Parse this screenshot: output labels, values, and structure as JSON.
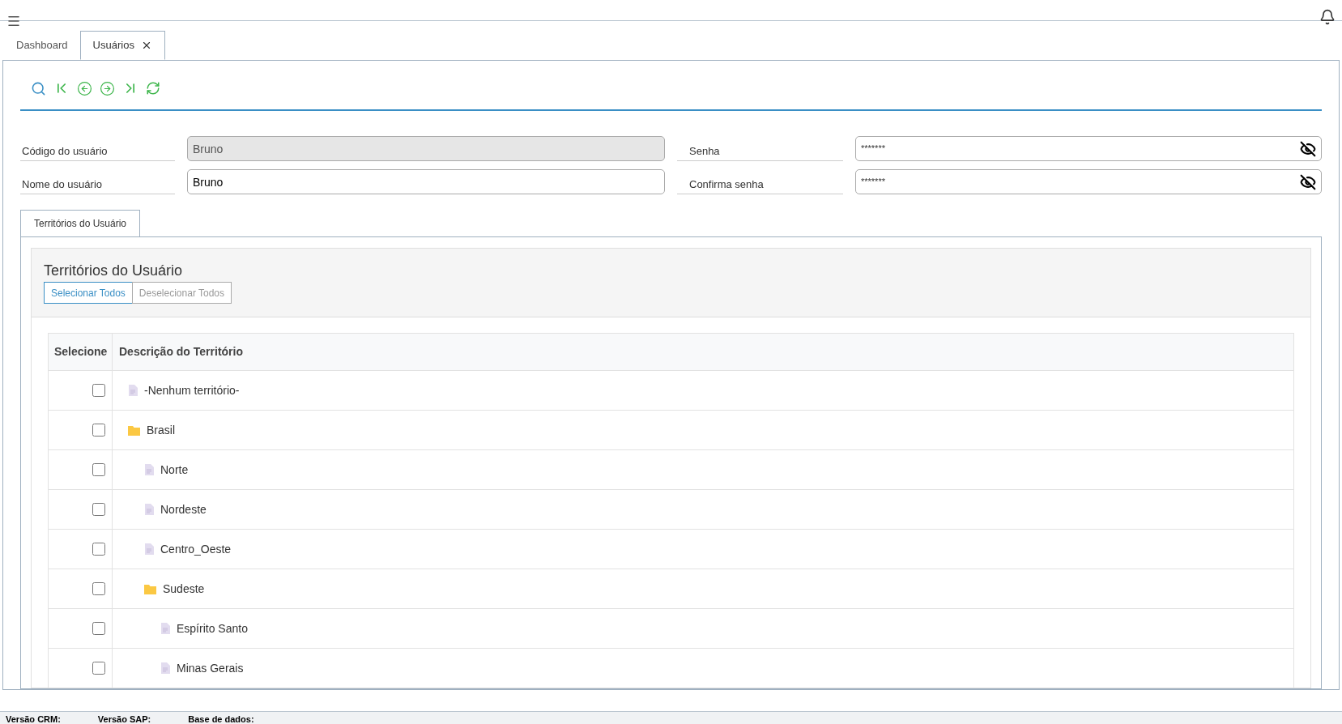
{
  "tabs": [
    {
      "label": "Dashboard",
      "selected": false,
      "closable": false
    },
    {
      "label": "Usuários",
      "selected": true,
      "closable": true
    }
  ],
  "form": {
    "left": [
      {
        "label": "Código do usuário",
        "value": "Bruno",
        "disabled": true
      },
      {
        "label": "Nome do usuário",
        "value": "Bruno",
        "disabled": false
      }
    ],
    "right": [
      {
        "label": "Senha",
        "value": "*******"
      },
      {
        "label": "Confirma senha",
        "value": "*******"
      }
    ]
  },
  "inner_tabs": [
    {
      "label": "Territórios do Usuário",
      "selected": true
    }
  ],
  "panel": {
    "title": "Territórios do Usuário",
    "buttons": [
      {
        "label": "Selecionar Todos",
        "selected": true
      },
      {
        "label": "Deselecionar Todos",
        "selected": false
      }
    ]
  },
  "table": {
    "columns": [
      "Selecione",
      "Descrição do Território"
    ],
    "rows": [
      {
        "label": "-Nenhum território-",
        "kind": "file",
        "checked": false
      },
      {
        "label": "Brasil",
        "kind": "folder",
        "checked": false,
        "children": [
          {
            "label": "Norte",
            "kind": "file",
            "checked": false
          },
          {
            "label": "Nordeste",
            "kind": "file",
            "checked": false
          },
          {
            "label": "Centro_Oeste",
            "kind": "file",
            "checked": false
          },
          {
            "label": "Sudeste",
            "kind": "folder",
            "checked": false,
            "children": [
              {
                "label": "Espírito Santo",
                "kind": "file",
                "checked": false
              },
              {
                "label": "Minas Gerais",
                "kind": "file",
                "checked": false
              }
            ]
          }
        ]
      }
    ]
  },
  "status_bar": [
    "Versão CRM:",
    "Versão SAP:",
    "Base de dados:"
  ]
}
